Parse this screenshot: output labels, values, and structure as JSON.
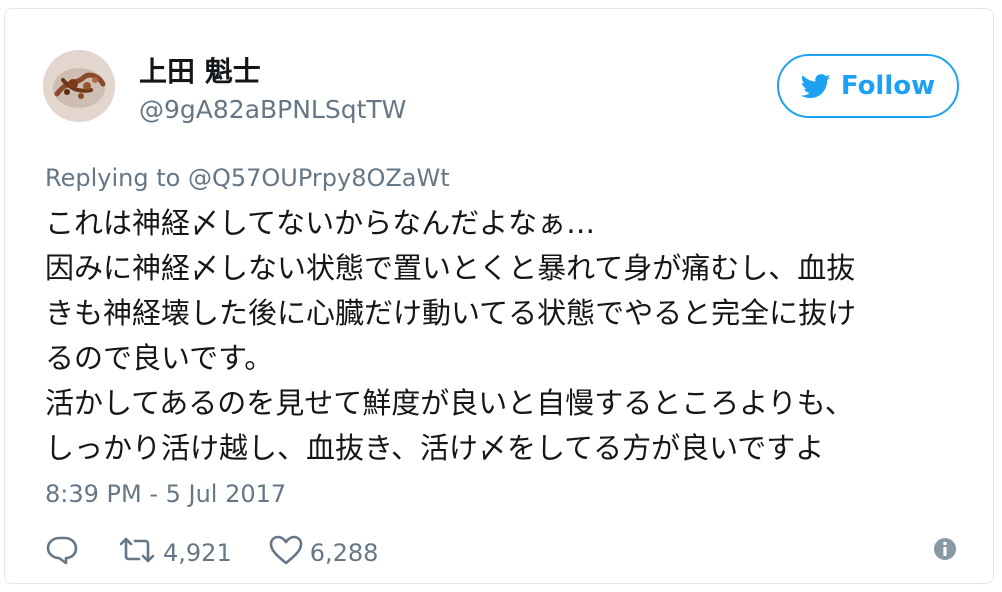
{
  "user": {
    "display_name": "上田 魁士",
    "screen_name": "@9gA82aBPNLSqtTW"
  },
  "follow_button": {
    "label": "Follow",
    "icon": "twitter-bird-icon"
  },
  "reply_context": {
    "prefix": "Replying to",
    "mention": "@Q57OUPrpy8OZaWt"
  },
  "tweet": {
    "lines": [
      "これは神経〆してないからなんだよなぁ…",
      "因みに神経〆しない状態で置いとくと暴れて身が痛むし、血抜",
      "きも神経壊した後に心臓だけ動いてる状態でやると完全に抜け",
      "るので良いです。",
      "活かしてあるのを見せて鮮度が良いと自慢するところよりも、",
      "しっかり活け越し、血抜き、活け〆をしてる方が良いですよ"
    ],
    "timestamp": "8:39 PM - 5 Jul 2017"
  },
  "actions": {
    "reply_icon": "reply-icon",
    "retweet_icon": "retweet-icon",
    "retweet_count": "4,921",
    "like_icon": "heart-icon",
    "like_count": "6,288",
    "info_icon": "info-icon"
  },
  "colors": {
    "accent": "#1da1f2",
    "secondary_text": "#657786",
    "primary_text": "#14171a",
    "border": "#e1e8ed"
  }
}
